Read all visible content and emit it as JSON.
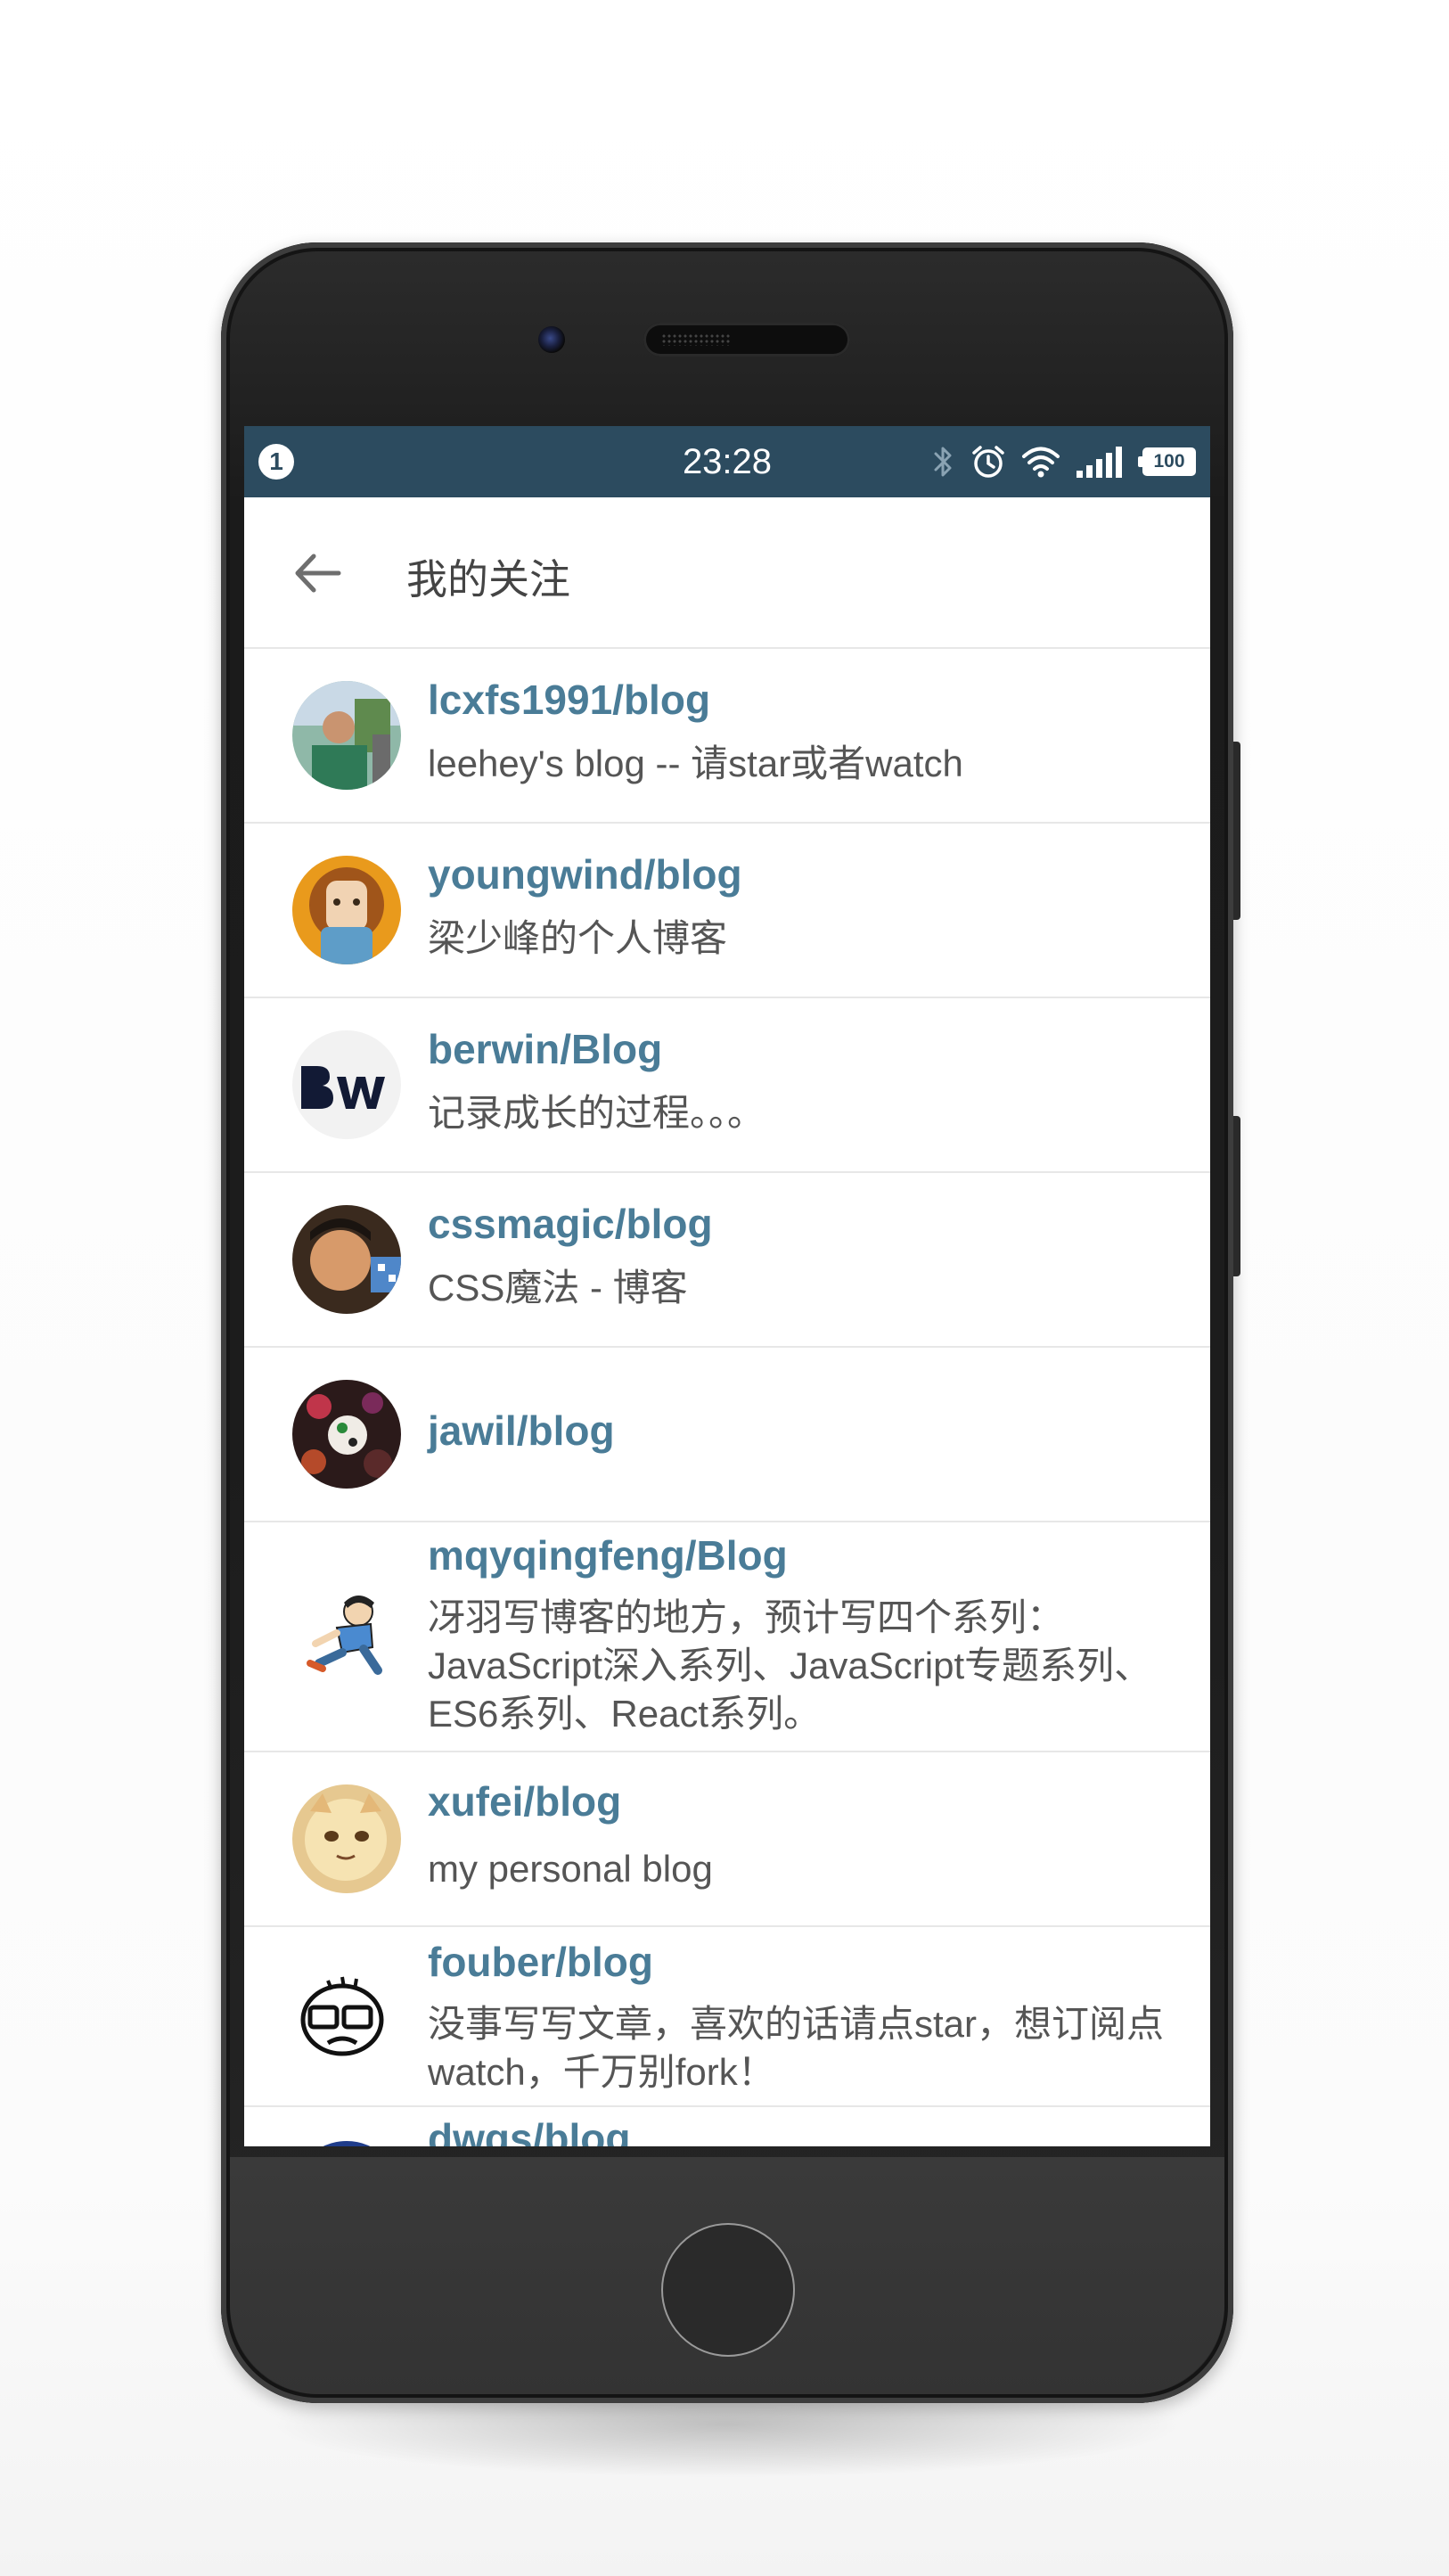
{
  "status_bar": {
    "notification_count": "1",
    "time": "23:28",
    "battery": "100"
  },
  "app_bar": {
    "title": "我的关注"
  },
  "repos": [
    {
      "name": "lcxfs1991/blog",
      "description": "leehey's blog -- 请star或者watch"
    },
    {
      "name": "youngwind/blog",
      "description": "梁少峰的个人博客"
    },
    {
      "name": "berwin/Blog",
      "description": "记录成长的过程。。。"
    },
    {
      "name": "cssmagic/blog",
      "description": "CSS魔法 - 博客"
    },
    {
      "name": "jawil/blog",
      "description": ""
    },
    {
      "name": "mqyqingfeng/Blog",
      "description": "冴羽写博客的地方，预计写四个系列：JavaScript深入系列、JavaScript专题系列、ES6系列、React系列。"
    },
    {
      "name": "xufei/blog",
      "description": "my personal blog"
    },
    {
      "name": "fouber/blog",
      "description": "没事写写文章，喜欢的话请点star，想订阅点watch，千万别fork！"
    },
    {
      "name": "dwqs/blog",
      "description": ""
    }
  ],
  "colors": {
    "status_bar": "#2c4b5f",
    "repo_name": "#4a7c97",
    "description": "#555555"
  },
  "icons": {
    "back": "arrow-left-icon",
    "bluetooth": "bluetooth-icon",
    "alarm": "alarm-icon",
    "wifi": "wifi-icon",
    "signal": "signal-icon",
    "battery": "battery-icon"
  }
}
